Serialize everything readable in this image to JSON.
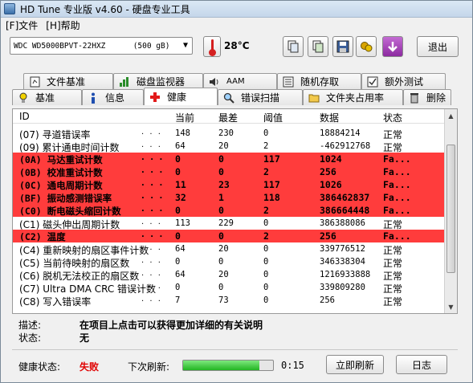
{
  "window": {
    "title": "HD Tune 专业版 v4.60 - 硬盘专业工具"
  },
  "menu": [
    "[F]文件",
    "[H]帮助"
  ],
  "toolbar": {
    "drive": "WDC WD5000BPVT-22HXZ      (500 gB)",
    "temperature": "28°C",
    "exit_label": "退出",
    "icons": [
      "copy-icon",
      "copy-all-icon",
      "save-icon",
      "options-icon",
      "download-icon"
    ]
  },
  "tabs_top": [
    {
      "label": "文件基准",
      "icon": "file-benchmark-icon"
    },
    {
      "label": "磁盘监视器",
      "icon": "disk-monitor-icon"
    },
    {
      "label": "AAM",
      "icon": "speaker-icon"
    },
    {
      "label": "随机存取",
      "icon": "random-access-icon"
    },
    {
      "label": "额外测试",
      "icon": "extra-tests-icon"
    }
  ],
  "tabs_bottom": [
    {
      "label": "基准",
      "icon": "benchmark-icon"
    },
    {
      "label": "信息",
      "icon": "info-icon"
    },
    {
      "label": "健康",
      "icon": "health-cross-icon"
    },
    {
      "label": "错误扫描",
      "icon": "error-scan-icon"
    },
    {
      "label": "文件夹占用率",
      "icon": "folder-icon"
    },
    {
      "label": "删除",
      "icon": "trash-icon"
    }
  ],
  "active_tab": "健康",
  "table": {
    "headers": {
      "id": "ID",
      "current": "当前",
      "worst": "最差",
      "threshold": "阈值",
      "data": "数据",
      "status": "状态"
    },
    "rows": [
      {
        "id": "(07) 寻道错误率",
        "current": "148",
        "worst": "230",
        "threshold": "0",
        "data": "18884214",
        "status": "正常",
        "bad": false
      },
      {
        "id": "(09) 累计通电时间计数",
        "current": "64",
        "worst": "20",
        "threshold": "2",
        "data": "-462912768",
        "status": "正常",
        "bad": false
      },
      {
        "id": "(0A) 马达重试计数",
        "current": "0",
        "worst": "0",
        "threshold": "117",
        "data": "1024",
        "status": "Fa...",
        "bad": true
      },
      {
        "id": "(0B) 校准重试计数",
        "current": "0",
        "worst": "0",
        "threshold": "2",
        "data": "256",
        "status": "Fa...",
        "bad": true
      },
      {
        "id": "(0C) 通电周期计数",
        "current": "11",
        "worst": "23",
        "threshold": "117",
        "data": "1026",
        "status": "Fa...",
        "bad": true
      },
      {
        "id": "(BF) 振动感测错误率",
        "current": "32",
        "worst": "1",
        "threshold": "118",
        "data": "386462837",
        "status": "Fa...",
        "bad": true
      },
      {
        "id": "(C0) 断电磁头缩回计数",
        "current": "0",
        "worst": "0",
        "threshold": "2",
        "data": "386664448",
        "status": "Fa...",
        "bad": true
      },
      {
        "id": "(C1) 磁头伸出周期计数",
        "current": "113",
        "worst": "229",
        "threshold": "0",
        "data": "386388086",
        "status": "正常",
        "bad": false
      },
      {
        "id": "(C2) 温度",
        "current": "0",
        "worst": "0",
        "threshold": "2",
        "data": "256",
        "status": "Fa...",
        "bad": true
      },
      {
        "id": "(C4) 重新映射的扇区事件计数",
        "current": "64",
        "worst": "20",
        "threshold": "0",
        "data": "339776512",
        "status": "正常",
        "bad": false
      },
      {
        "id": "(C5) 当前待映射的扇区数",
        "current": "0",
        "worst": "0",
        "threshold": "0",
        "data": "346338304",
        "status": "正常",
        "bad": false
      },
      {
        "id": "(C6) 脱机无法校正的扇区数",
        "current": "64",
        "worst": "20",
        "threshold": "0",
        "data": "1216933888",
        "status": "正常",
        "bad": false
      },
      {
        "id": "(C7) Ultra DMA CRC 错误计数",
        "current": "0",
        "worst": "0",
        "threshold": "0",
        "data": "339809280",
        "status": "正常",
        "bad": false
      },
      {
        "id": "(C8) 写入错误率",
        "current": "7",
        "worst": "73",
        "threshold": "0",
        "data": "256",
        "status": "正常",
        "bad": false
      }
    ]
  },
  "description": {
    "label": "描述:",
    "value": "在项目上点击可以获得更加详细的有关说明"
  },
  "state": {
    "label": "状态:",
    "value": "无"
  },
  "footer": {
    "health_label": "健康状态:",
    "health_value": "失败",
    "next_refresh_label": "下次刷新:",
    "refresh_progress": 0.85,
    "countdown": "0:15",
    "refresh_button": "立即刷新",
    "log_button": "日志"
  },
  "colors": {
    "fail_row": "#ff3c3c",
    "fail_text": "#e00000",
    "progress": "#22b522"
  }
}
